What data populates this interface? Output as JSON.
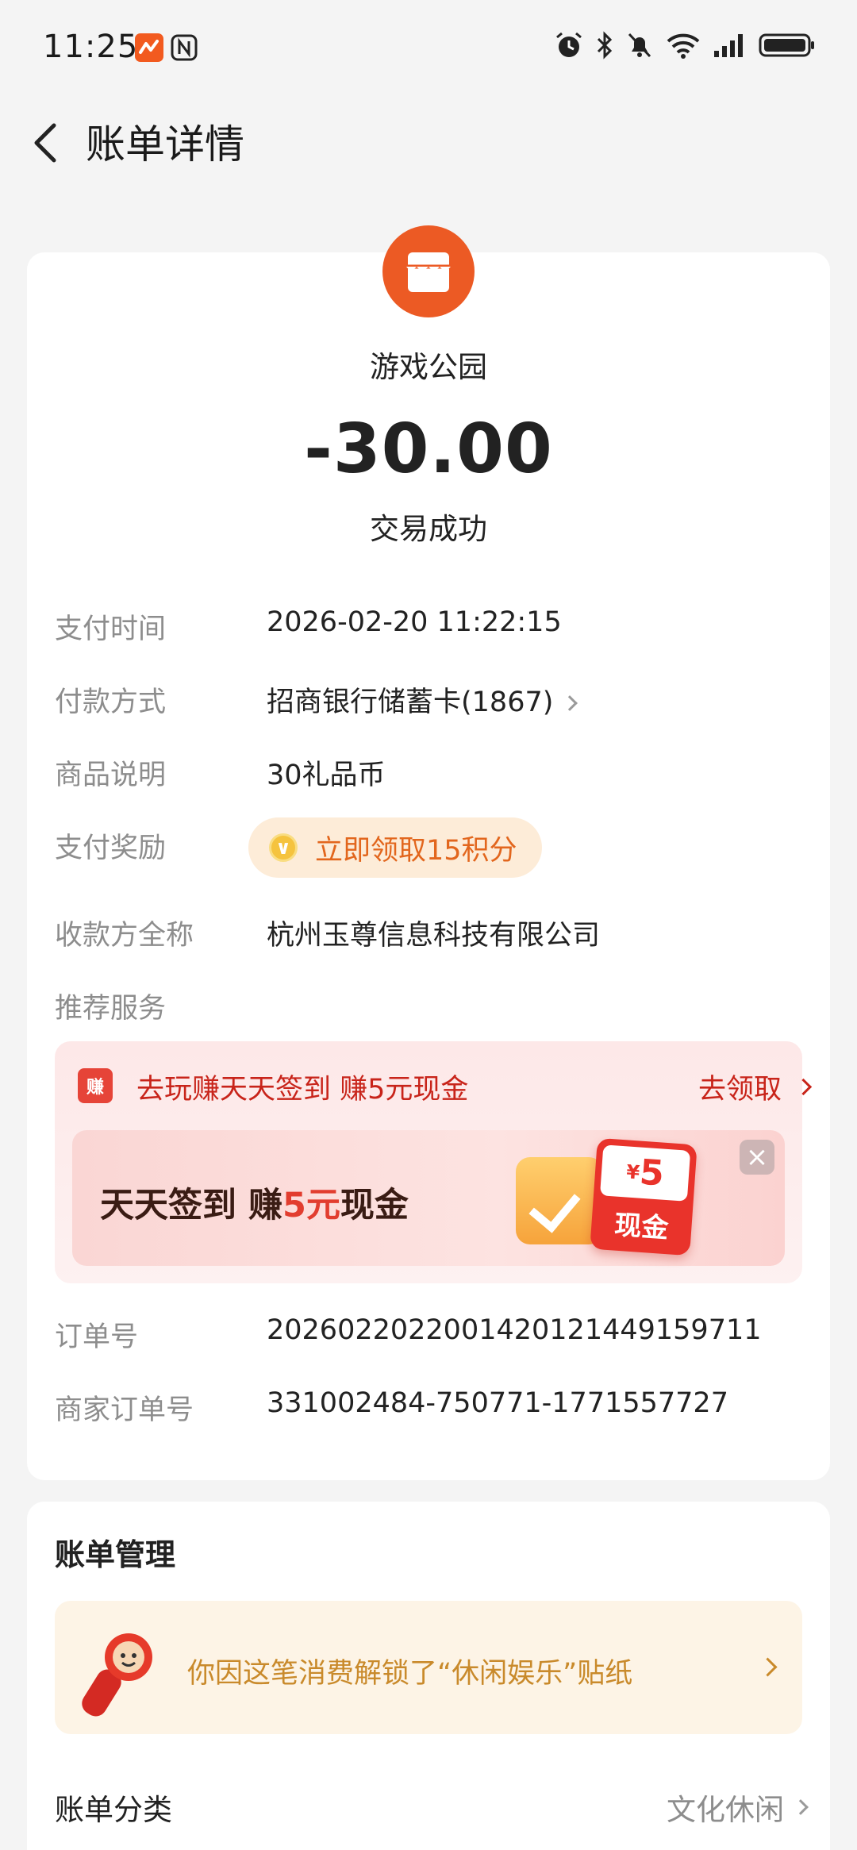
{
  "status_bar": {
    "time": "11:25"
  },
  "header": {
    "title": "账单详情"
  },
  "merchant": {
    "name": "游戏公园",
    "amount": "-30.00",
    "status": "交易成功"
  },
  "details": [
    {
      "label": "支付时间",
      "value": "2026-02-20 11:22:15"
    },
    {
      "label": "付款方式",
      "value": "招商银行储蓄卡(1867)"
    },
    {
      "label": "商品说明",
      "value": "30礼品币"
    },
    {
      "label": "支付奖励",
      "value": "立即领取15积分"
    },
    {
      "label": "收款方全称",
      "value": "杭州玉尊信息科技有限公司"
    },
    {
      "label": "推荐服务"
    }
  ],
  "promo": {
    "icon_text": "赚",
    "title": "去玩赚天天签到 赚5元现金",
    "link": "去领取",
    "banner_prefix": "天天签到 赚",
    "banner_highlight": "5元",
    "banner_suffix": "现金",
    "cash_symbol": "¥",
    "cash_amount": "5",
    "cash_label": "现金"
  },
  "orders": [
    {
      "label": "订单号",
      "value": "2026022022001420121449159711"
    },
    {
      "label": "商家订单号",
      "value": "331002484-750771-1771557727"
    }
  ],
  "management": {
    "title": "账单管理",
    "sticker_text": "你因这笔消费解锁了“休闲娱乐”贴纸",
    "category_label": "账单分类",
    "category_value": "文化休闲"
  }
}
